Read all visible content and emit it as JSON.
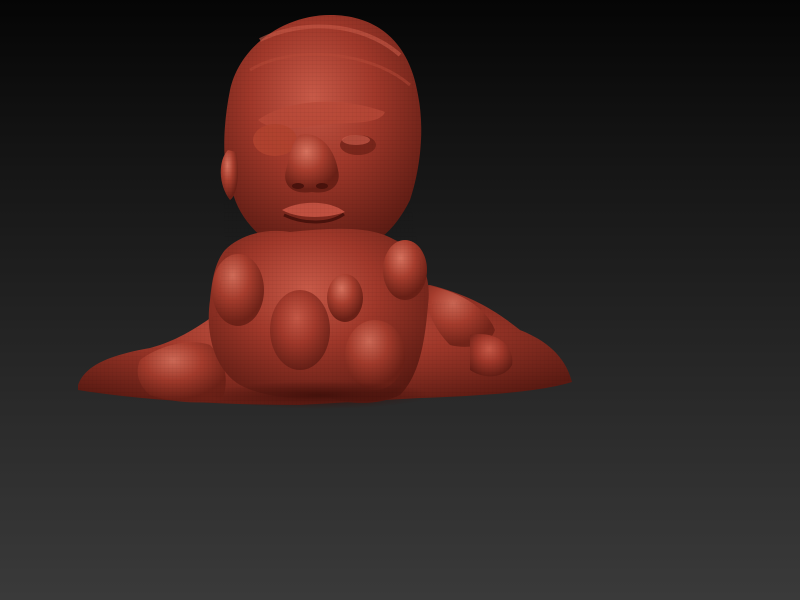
{
  "viewport": {
    "background_top": "#050505",
    "background_bottom": "#3a3a3a"
  },
  "model": {
    "icon": "sculpted-bust-icon",
    "material_color": "#a0382a",
    "highlight_color": "#c85a48",
    "shadow_color": "#5a1a12"
  }
}
